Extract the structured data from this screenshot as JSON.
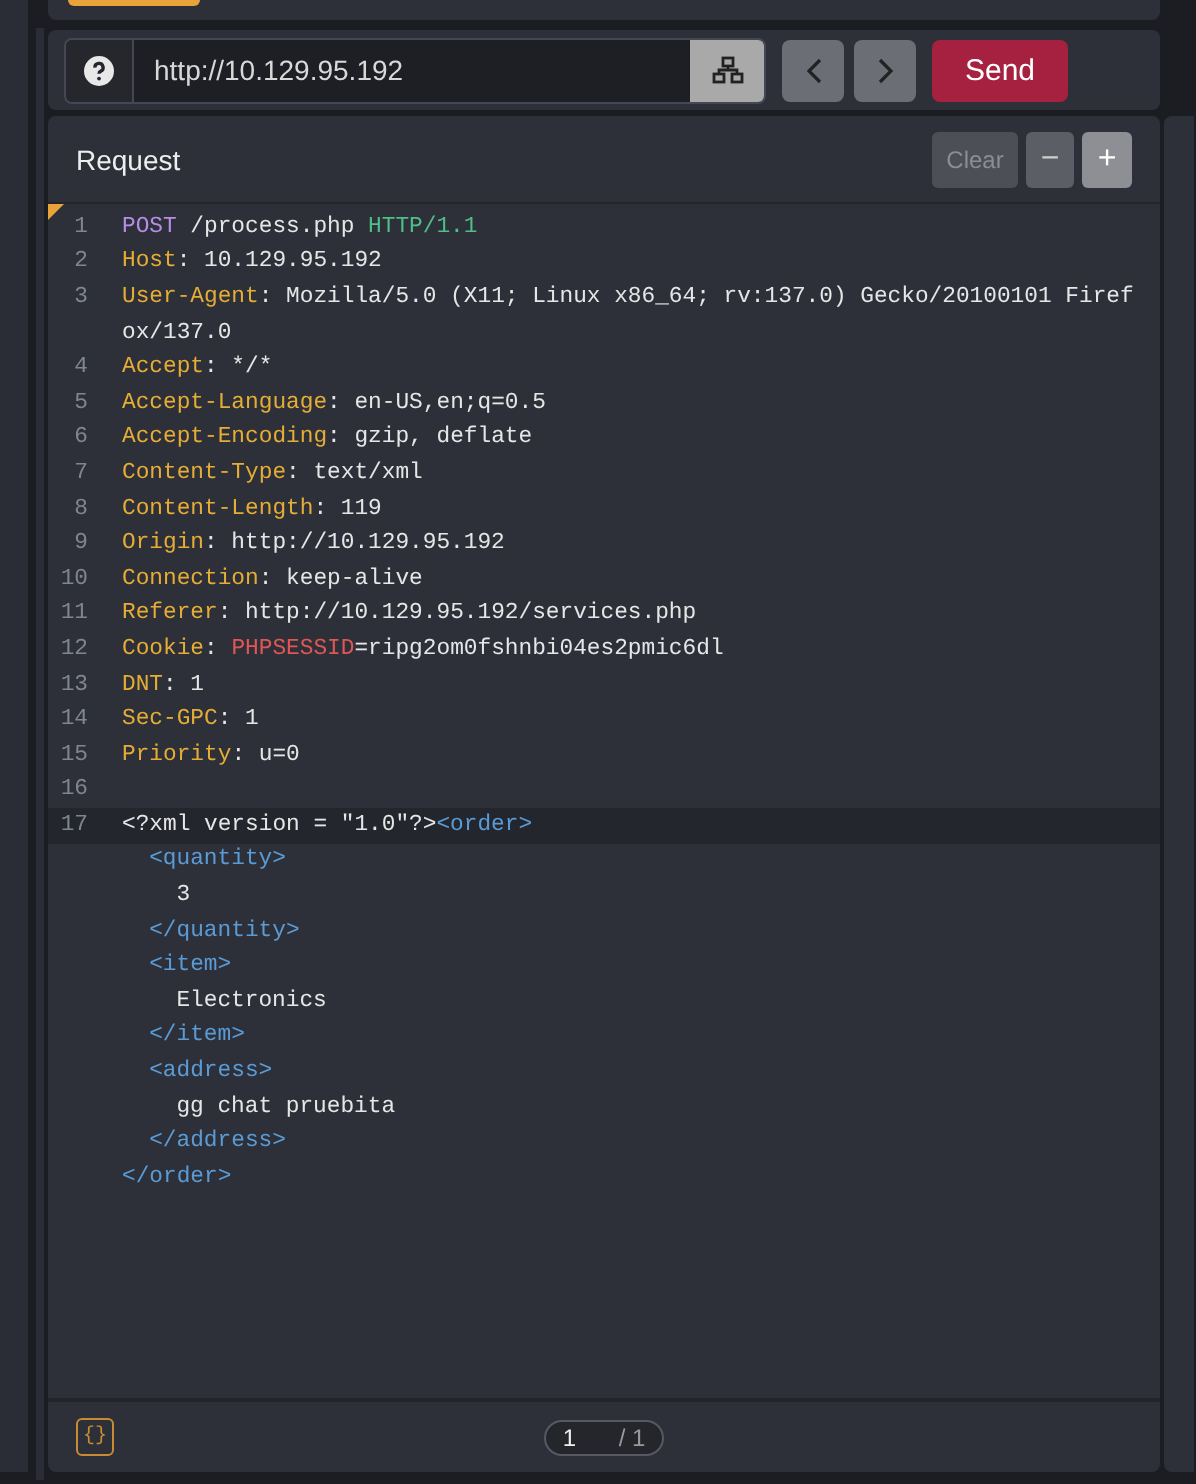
{
  "url_bar": {
    "value": "http://10.129.95.192",
    "send_label": "Send"
  },
  "request": {
    "title": "Request",
    "clear": {
      "label": "Clear",
      "disabled": true
    },
    "zoom_out": "−",
    "zoom_in": "+",
    "lines": [
      {
        "number": "1",
        "active": false,
        "segments": [
          {
            "kind": "method",
            "text": "POST"
          },
          {
            "kind": "plain",
            "text": " /process.php "
          },
          {
            "kind": "version",
            "text": "HTTP/1.1"
          }
        ]
      },
      {
        "number": "2",
        "active": false,
        "segments": [
          {
            "kind": "key",
            "text": "Host"
          },
          {
            "kind": "plain",
            "text": ": 10.129.95.192"
          }
        ]
      },
      {
        "number": "3",
        "active": false,
        "segments": [
          {
            "kind": "key",
            "text": "User-Agent"
          },
          {
            "kind": "plain",
            "text": ": Mozilla/5.0 (X11; Linux x86_64; rv:137.0) Gecko/20100101 Firef"
          }
        ]
      },
      {
        "active": false,
        "segments": [
          {
            "kind": "plain",
            "text": "ox/137.0"
          }
        ]
      },
      {
        "number": "4",
        "active": false,
        "segments": [
          {
            "kind": "key",
            "text": "Accept"
          },
          {
            "kind": "plain",
            "text": ": */*"
          }
        ]
      },
      {
        "number": "5",
        "active": false,
        "segments": [
          {
            "kind": "key",
            "text": "Accept-Language"
          },
          {
            "kind": "plain",
            "text": ": en-US,en;q=0.5"
          }
        ]
      },
      {
        "number": "6",
        "active": false,
        "segments": [
          {
            "kind": "key",
            "text": "Accept-Encoding"
          },
          {
            "kind": "plain",
            "text": ": gzip, deflate"
          }
        ]
      },
      {
        "number": "7",
        "active": false,
        "segments": [
          {
            "kind": "key",
            "text": "Content-Type"
          },
          {
            "kind": "plain",
            "text": ": text/xml"
          }
        ]
      },
      {
        "number": "8",
        "active": false,
        "segments": [
          {
            "kind": "key",
            "text": "Content-Length"
          },
          {
            "kind": "plain",
            "text": ": 119"
          }
        ]
      },
      {
        "number": "9",
        "active": false,
        "segments": [
          {
            "kind": "key",
            "text": "Origin"
          },
          {
            "kind": "plain",
            "text": ": http://10.129.95.192"
          }
        ]
      },
      {
        "number": "10",
        "active": false,
        "segments": [
          {
            "kind": "key",
            "text": "Connection"
          },
          {
            "kind": "plain",
            "text": ": keep-alive"
          }
        ]
      },
      {
        "number": "11",
        "active": false,
        "segments": [
          {
            "kind": "key",
            "text": "Referer"
          },
          {
            "kind": "plain",
            "text": ": http://10.129.95.192/services.php"
          }
        ]
      },
      {
        "number": "12",
        "active": false,
        "segments": [
          {
            "kind": "key",
            "text": "Cookie"
          },
          {
            "kind": "plain",
            "text": ": "
          },
          {
            "kind": "cookie",
            "text": "PHPSESSID"
          },
          {
            "kind": "plain",
            "text": "=ripg2om0fshnbi04es2pmic6dl"
          }
        ]
      },
      {
        "number": "13",
        "active": false,
        "segments": [
          {
            "kind": "key",
            "text": "DNT"
          },
          {
            "kind": "plain",
            "text": ": 1"
          }
        ]
      },
      {
        "number": "14",
        "active": false,
        "segments": [
          {
            "kind": "key",
            "text": "Sec-GPC"
          },
          {
            "kind": "plain",
            "text": ": 1"
          }
        ]
      },
      {
        "number": "15",
        "active": false,
        "segments": [
          {
            "kind": "key",
            "text": "Priority"
          },
          {
            "kind": "plain",
            "text": ": u=0"
          }
        ]
      },
      {
        "number": "16",
        "active": false
      },
      {
        "number": "17",
        "active": true,
        "segments": [
          {
            "kind": "plain",
            "text": "<?xml version = \"1.0\"?>"
          },
          {
            "kind": "tag",
            "text": "<order>"
          }
        ],
        "children": [
          {
            "segments": [
              {
                "kind": "tag",
                "text": "<quantity>"
              }
            ],
            "children": [
              {
                "segments": [
                  {
                    "kind": "plain",
                    "text": "3"
                  }
                ]
              }
            ]
          },
          {
            "segments": [
              {
                "kind": "tag",
                "text": "</quantity>"
              }
            ]
          },
          {
            "segments": [
              {
                "kind": "tag",
                "text": "<item>"
              }
            ],
            "children": [
              {
                "segments": [
                  {
                    "kind": "plain",
                    "text": "Electronics"
                  }
                ]
              }
            ]
          },
          {
            "segments": [
              {
                "kind": "tag",
                "text": "</item>"
              }
            ]
          },
          {
            "segments": [
              {
                "kind": "tag",
                "text": "<address>"
              }
            ],
            "children": [
              {
                "segments": [
                  {
                    "kind": "plain",
                    "text": "gg chat pruebita"
                  }
                ]
              }
            ]
          },
          {
            "segments": [
              {
                "kind": "tag",
                "text": "</address>"
              }
            ]
          }
        ]
      },
      {
        "active": false,
        "segments": [
          {
            "kind": "tag",
            "text": "</order>"
          }
        ]
      }
    ],
    "footer": {
      "format_button": "{}",
      "page": "1",
      "total": "/ 1"
    }
  }
}
